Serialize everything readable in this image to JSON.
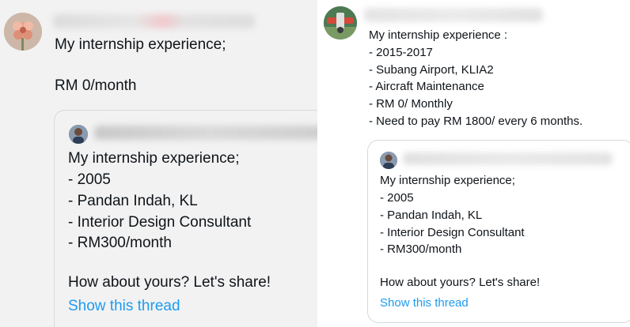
{
  "left_post": {
    "author_name_blurred": true,
    "avatar_icon": "flower-avatar-icon",
    "body_lines": [
      "My internship experience;",
      "RM 0/month"
    ],
    "quoted_post": {
      "avatar_icon": "person-avatar-icon",
      "author_name_blurred": true,
      "body_lines": [
        "My internship experience;",
        "- 2005",
        "- Pandan Indah, KL",
        "- Interior Design Consultant",
        "- RM300/month",
        "How about yours? Let's share!"
      ],
      "thread_link": "Show this thread"
    }
  },
  "right_post": {
    "author_name_blurred": true,
    "avatar_icon": "aircraft-avatar-icon",
    "body_lines": [
      "My internship experience :",
      "- 2015-2017",
      "- Subang Airport, KLIA2",
      "- Aircraft Maintenance",
      "- RM 0/ Monthly",
      "- Need to pay RM 1800/ every 6 months."
    ],
    "quoted_post": {
      "avatar_icon": "person-avatar-icon",
      "author_name_blurred": true,
      "body_lines": [
        "My internship experience;",
        "- 2005",
        "- Pandan Indah, KL",
        "- Interior Design Consultant",
        "- RM300/month",
        "How about yours? Let's share!"
      ],
      "thread_link": "Show this thread"
    }
  },
  "colors": {
    "link": "#1d9bf0",
    "text": "#0f1419",
    "left_background": "#f2f2f2",
    "right_background": "#ffffff",
    "card_border": "#d6d9db"
  }
}
